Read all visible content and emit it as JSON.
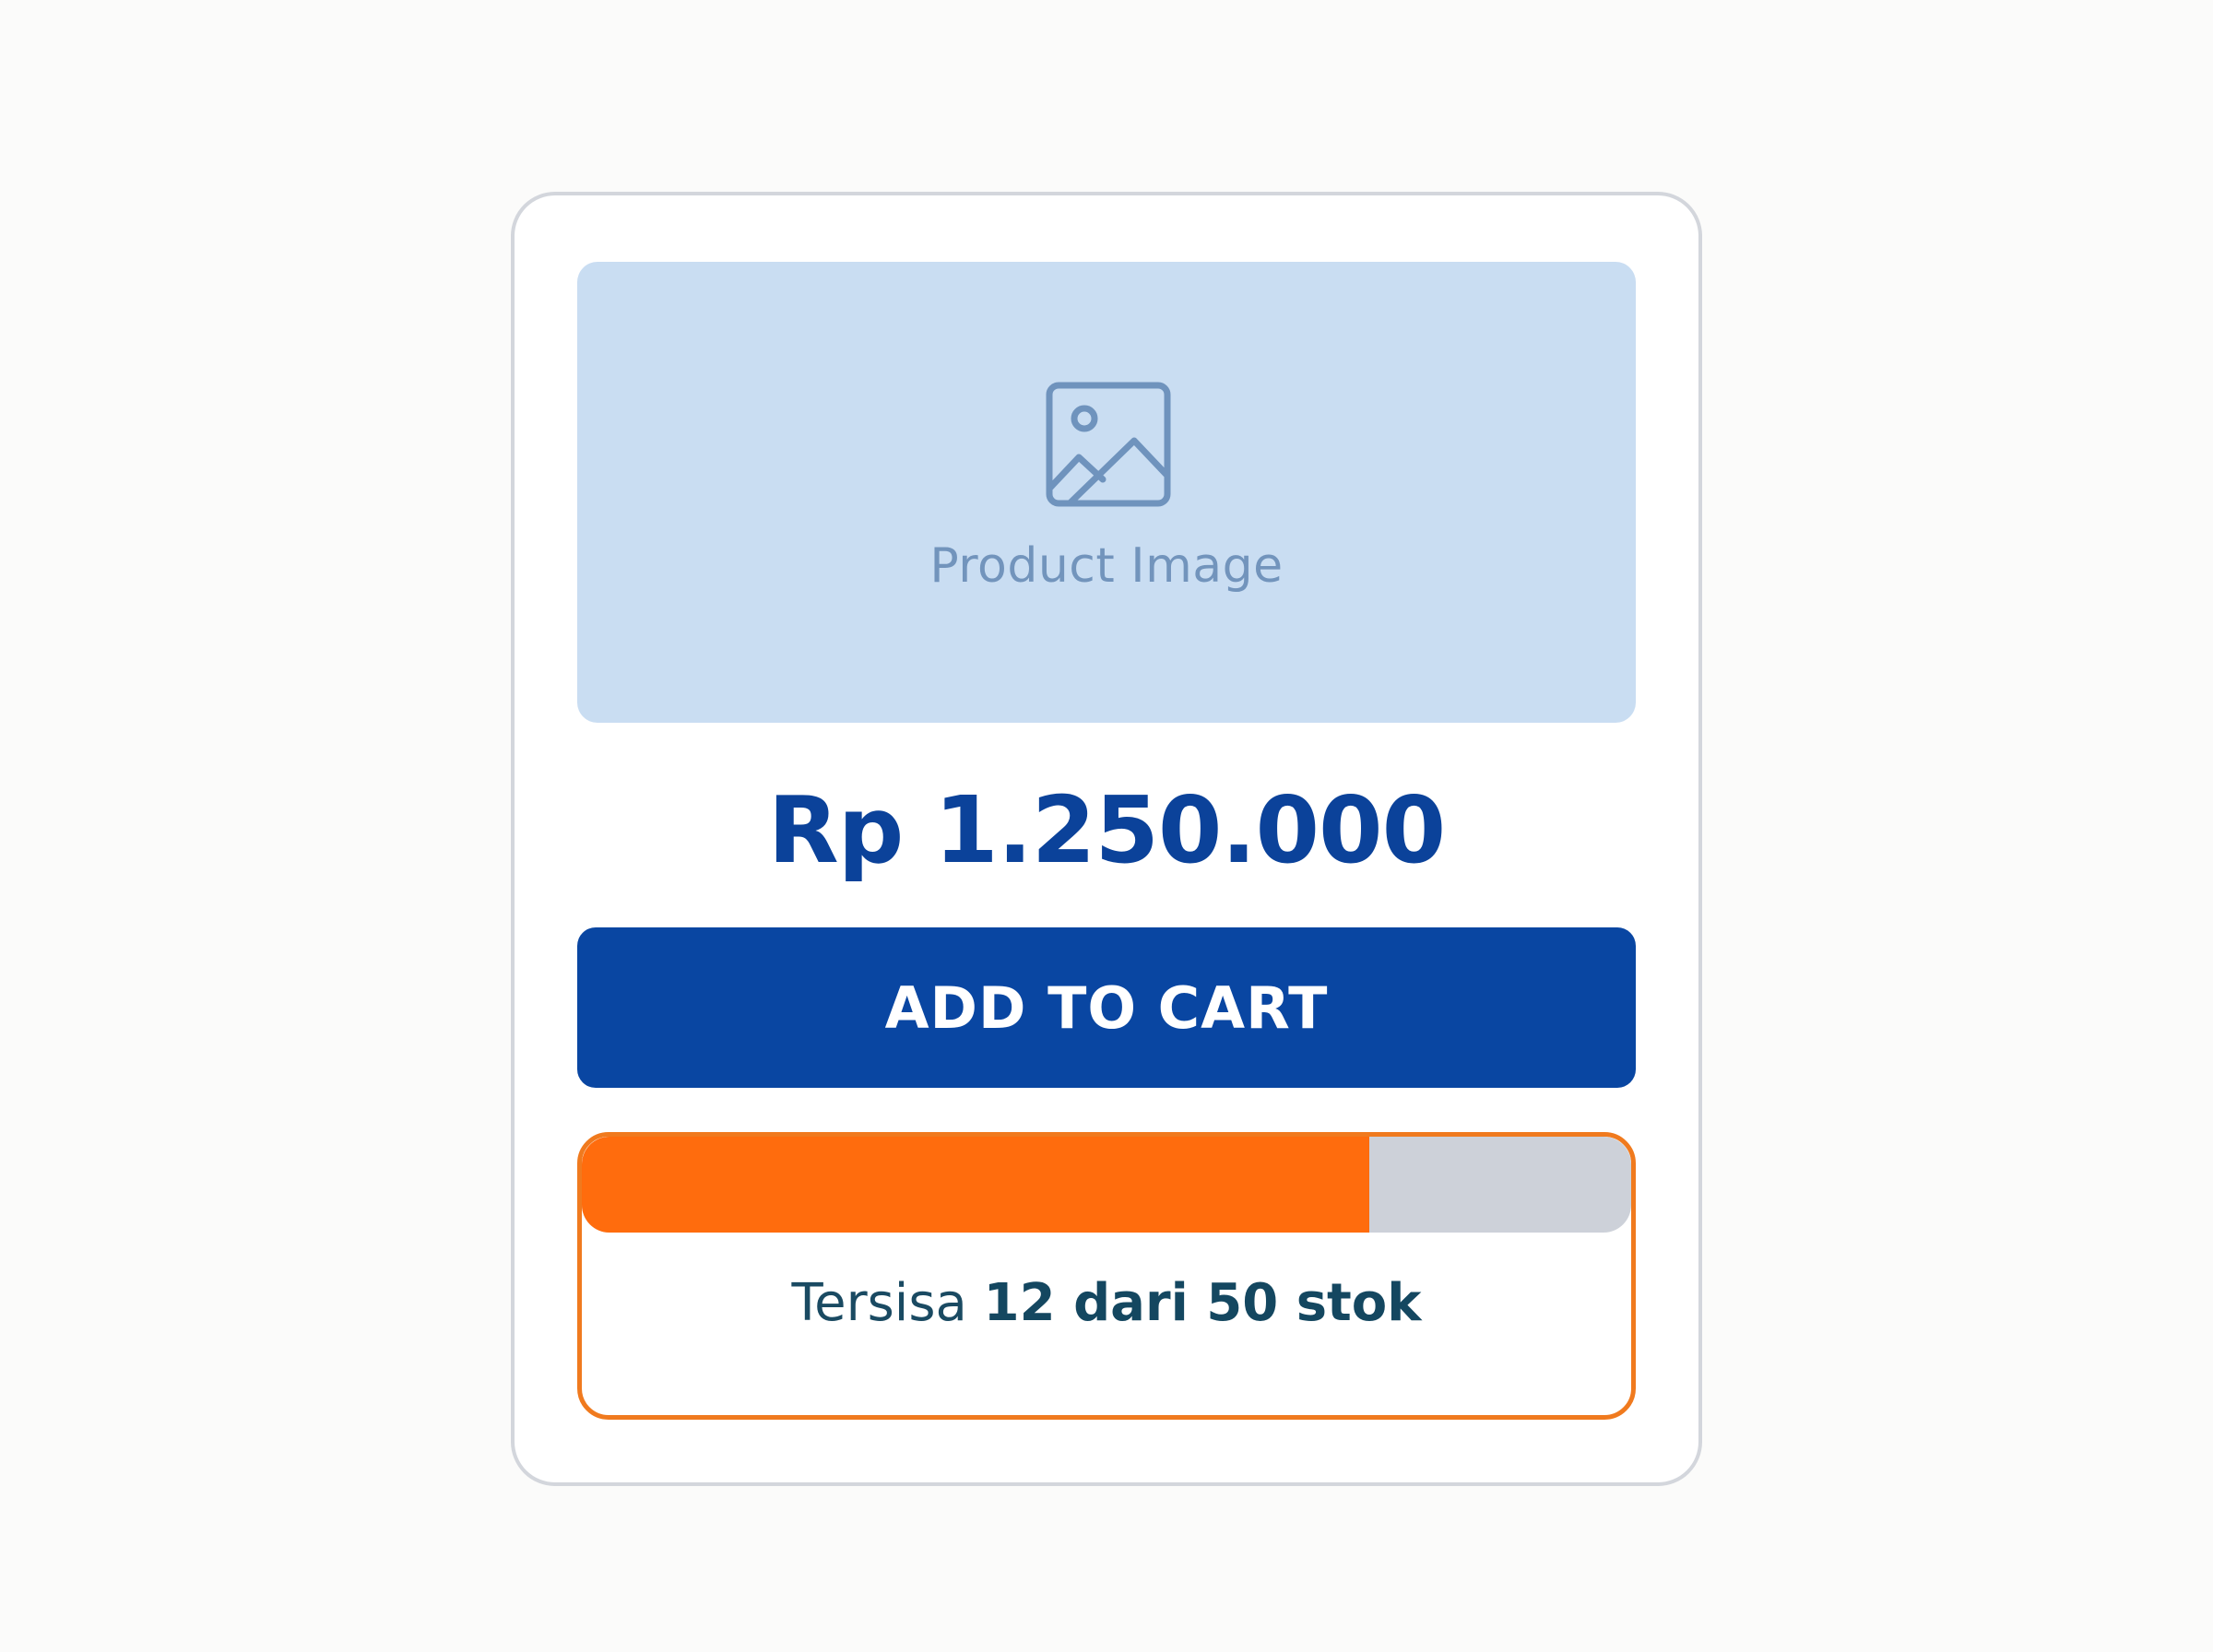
{
  "product_card": {
    "image_placeholder": {
      "icon": "image-icon",
      "label": "Product Image"
    },
    "price": "Rp 1.250.000",
    "add_to_cart_label": "ADD TO CART",
    "stock": {
      "prefix": "Tersisa",
      "highlight": "12 dari 50 stok",
      "remaining_fraction": 0.75
    }
  },
  "colors": {
    "page_background": "#fbfbfa",
    "card_border": "#d3d6dc",
    "image_background": "#c9ddf2",
    "price_text": "#0b429a",
    "button_background": "#0946a2",
    "progress_fill": "#ff6c0d",
    "progress_track": "#cdd1d9",
    "stock_border": "#f07a1e",
    "stock_text": "#1a4a62"
  }
}
